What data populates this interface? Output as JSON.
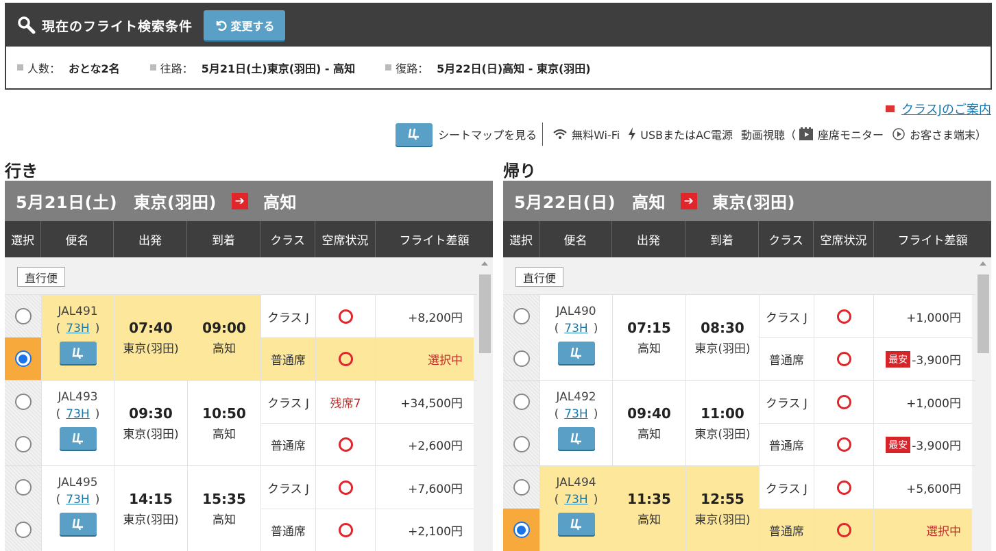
{
  "search": {
    "title": "現在のフライト検索条件",
    "change_label": "変更する",
    "people_label": "人数：",
    "people_value": "おとな2名",
    "outbound_label": "往路：",
    "outbound_value": "5月21日(土)東京(羽田) - 高知",
    "return_label": "復路：",
    "return_value": "5月22日(日)高知 - 東京(羽田)"
  },
  "classj_link": "クラスJのご案内",
  "legend": {
    "seatmap": "シートマップを見る",
    "wifi": "無料Wi-Fi",
    "power": "USBまたはAC電源",
    "video_prefix": "動画視聴（",
    "monitor": "座席モニター",
    "device": "お客さま端末）"
  },
  "columns": [
    "選択",
    "便名",
    "出発",
    "到着",
    "クラス",
    "空席状況",
    "フライト差額"
  ],
  "outbound": {
    "heading": "行き",
    "date": "5月21日(土)",
    "from": "東京(羽田)",
    "to": "高知",
    "direct": "直行便",
    "flights": [
      {
        "no": "JAL491",
        "ac": "73H",
        "dep": "07:40",
        "dep_ap": "東京(羽田)",
        "arr": "09:00",
        "arr_ap": "高知",
        "classes": [
          {
            "name": "クラス J",
            "avail": "○",
            "price": "+8,200円"
          },
          {
            "name": "普通席",
            "avail": "○",
            "price": "選択中"
          }
        ]
      },
      {
        "no": "JAL493",
        "ac": "73H",
        "dep": "09:30",
        "dep_ap": "東京(羽田)",
        "arr": "10:50",
        "arr_ap": "高知",
        "classes": [
          {
            "name": "クラス J",
            "avail": "残席7",
            "price": "+34,500円"
          },
          {
            "name": "普通席",
            "avail": "○",
            "price": "+2,600円"
          }
        ]
      },
      {
        "no": "JAL495",
        "ac": "73H",
        "dep": "14:15",
        "dep_ap": "東京(羽田)",
        "arr": "15:35",
        "arr_ap": "高知",
        "classes": [
          {
            "name": "クラス J",
            "avail": "○",
            "price": "+7,600円"
          },
          {
            "name": "普通席",
            "avail": "○",
            "price": "+2,100円"
          }
        ]
      }
    ]
  },
  "inbound": {
    "heading": "帰り",
    "date": "5月22日(日)",
    "from": "高知",
    "to": "東京(羽田)",
    "direct": "直行便",
    "cheap_badge": "最安",
    "flights": [
      {
        "no": "JAL490",
        "ac": "73H",
        "dep": "07:15",
        "dep_ap": "高知",
        "arr": "08:30",
        "arr_ap": "東京(羽田)",
        "classes": [
          {
            "name": "クラス J",
            "avail": "○",
            "price": "+1,000円"
          },
          {
            "name": "普通席",
            "avail": "○",
            "price": "-3,900円"
          }
        ]
      },
      {
        "no": "JAL492",
        "ac": "73H",
        "dep": "09:40",
        "dep_ap": "高知",
        "arr": "11:00",
        "arr_ap": "東京(羽田)",
        "classes": [
          {
            "name": "クラス J",
            "avail": "○",
            "price": "+1,000円"
          },
          {
            "name": "普通席",
            "avail": "○",
            "price": "-3,900円"
          }
        ]
      },
      {
        "no": "JAL494",
        "ac": "73H",
        "dep": "11:35",
        "dep_ap": "高知",
        "arr": "12:55",
        "arr_ap": "東京(羽田)",
        "classes": [
          {
            "name": "クラス J",
            "avail": "○",
            "price": "+5,600円"
          },
          {
            "name": "普通席",
            "avail": "○",
            "price": "選択中"
          }
        ]
      }
    ]
  }
}
